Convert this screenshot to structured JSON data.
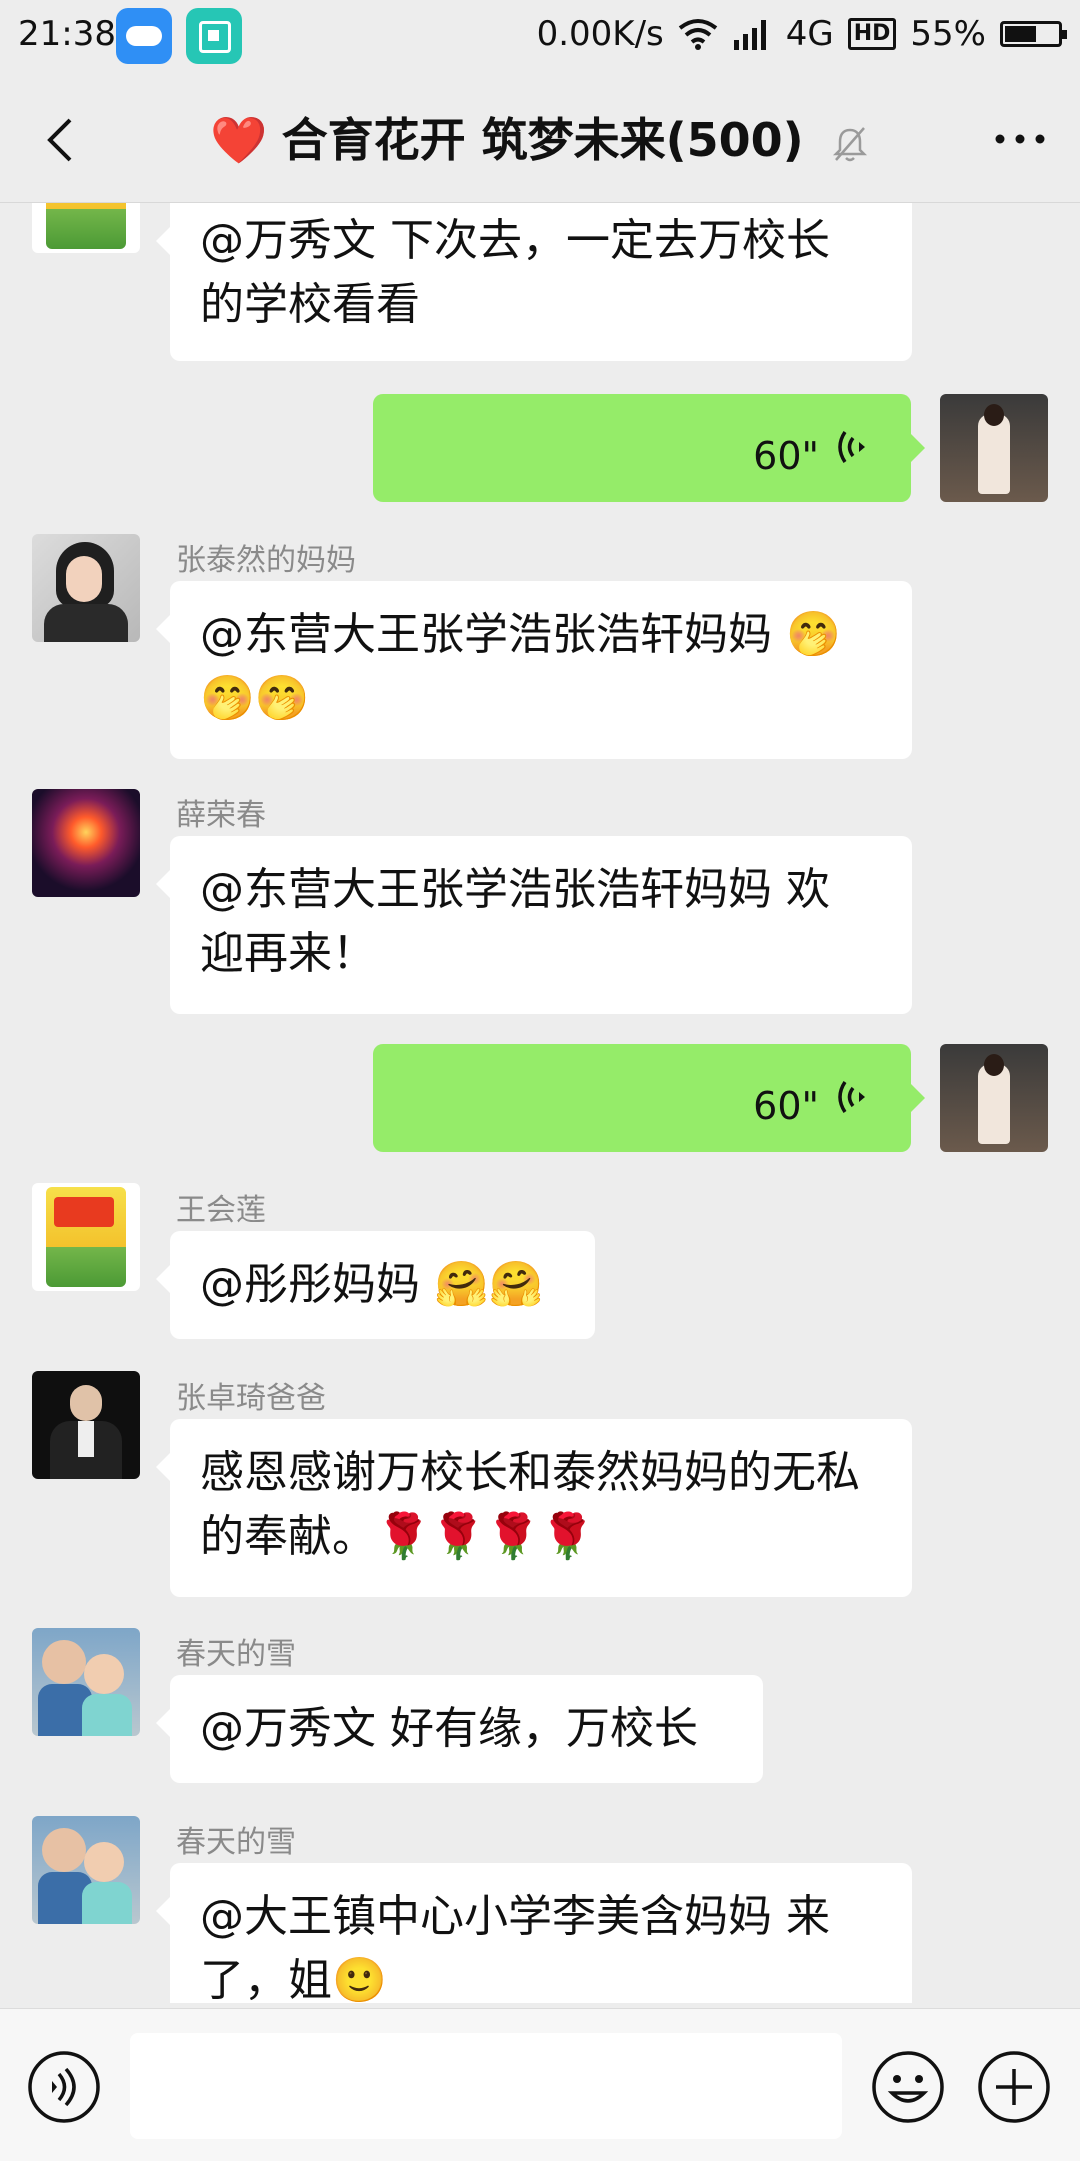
{
  "status_bar": {
    "time": "21:38",
    "net_speed": "0.00K/s",
    "network": "4G",
    "hd": "HD",
    "battery": "55%",
    "icons": [
      "weather-icon",
      "screen-scan-icon",
      "wifi-icon",
      "signal-icon",
      "battery-icon"
    ]
  },
  "header": {
    "title": "合育花开 筑梦未来(500)",
    "title_emoji": "❤️",
    "icons": [
      "back-arrow-icon",
      "mute-bell-icon",
      "more-dots-icon"
    ]
  },
  "messages": [
    {
      "sender": "",
      "text_line1": "@万秀文  下次去，一定去万校长",
      "text_line2": "的学校看看"
    },
    {
      "self": true,
      "type": "voice",
      "duration": "60\""
    },
    {
      "sender": "张泰然的妈妈",
      "text_line1": "@东营大王张学浩张浩轩妈妈 🤭",
      "text_line2": "🤭🤭"
    },
    {
      "sender": "薛荣春",
      "text_line1": "@东营大王张学浩张浩轩妈妈  欢",
      "text_line2": "迎再来！"
    },
    {
      "self": true,
      "type": "voice",
      "duration": "60\""
    },
    {
      "sender": "王会莲",
      "text_line1": "@彤彤妈妈  🤗🤗"
    },
    {
      "sender": "张卓琦爸爸",
      "text_line1": "感恩感谢万校长和泰然妈妈的无私",
      "text_line2": "的奉献。🌹🌹🌹🌹"
    },
    {
      "sender": "春天的雪",
      "text_line1": "@万秀文  好有缘，万校长"
    },
    {
      "sender": "春天的雪",
      "text_line1": "@大王镇中心小学李美含妈妈  来",
      "text_line2": "了，姐🙂"
    }
  ],
  "input_bar": {
    "placeholder": "",
    "icons": [
      "voice-toggle-icon",
      "emoji-icon",
      "plus-icon"
    ]
  },
  "colors": {
    "background": "#ededed",
    "voice_bubble": "#95ec69",
    "bubble": "#ffffff"
  }
}
